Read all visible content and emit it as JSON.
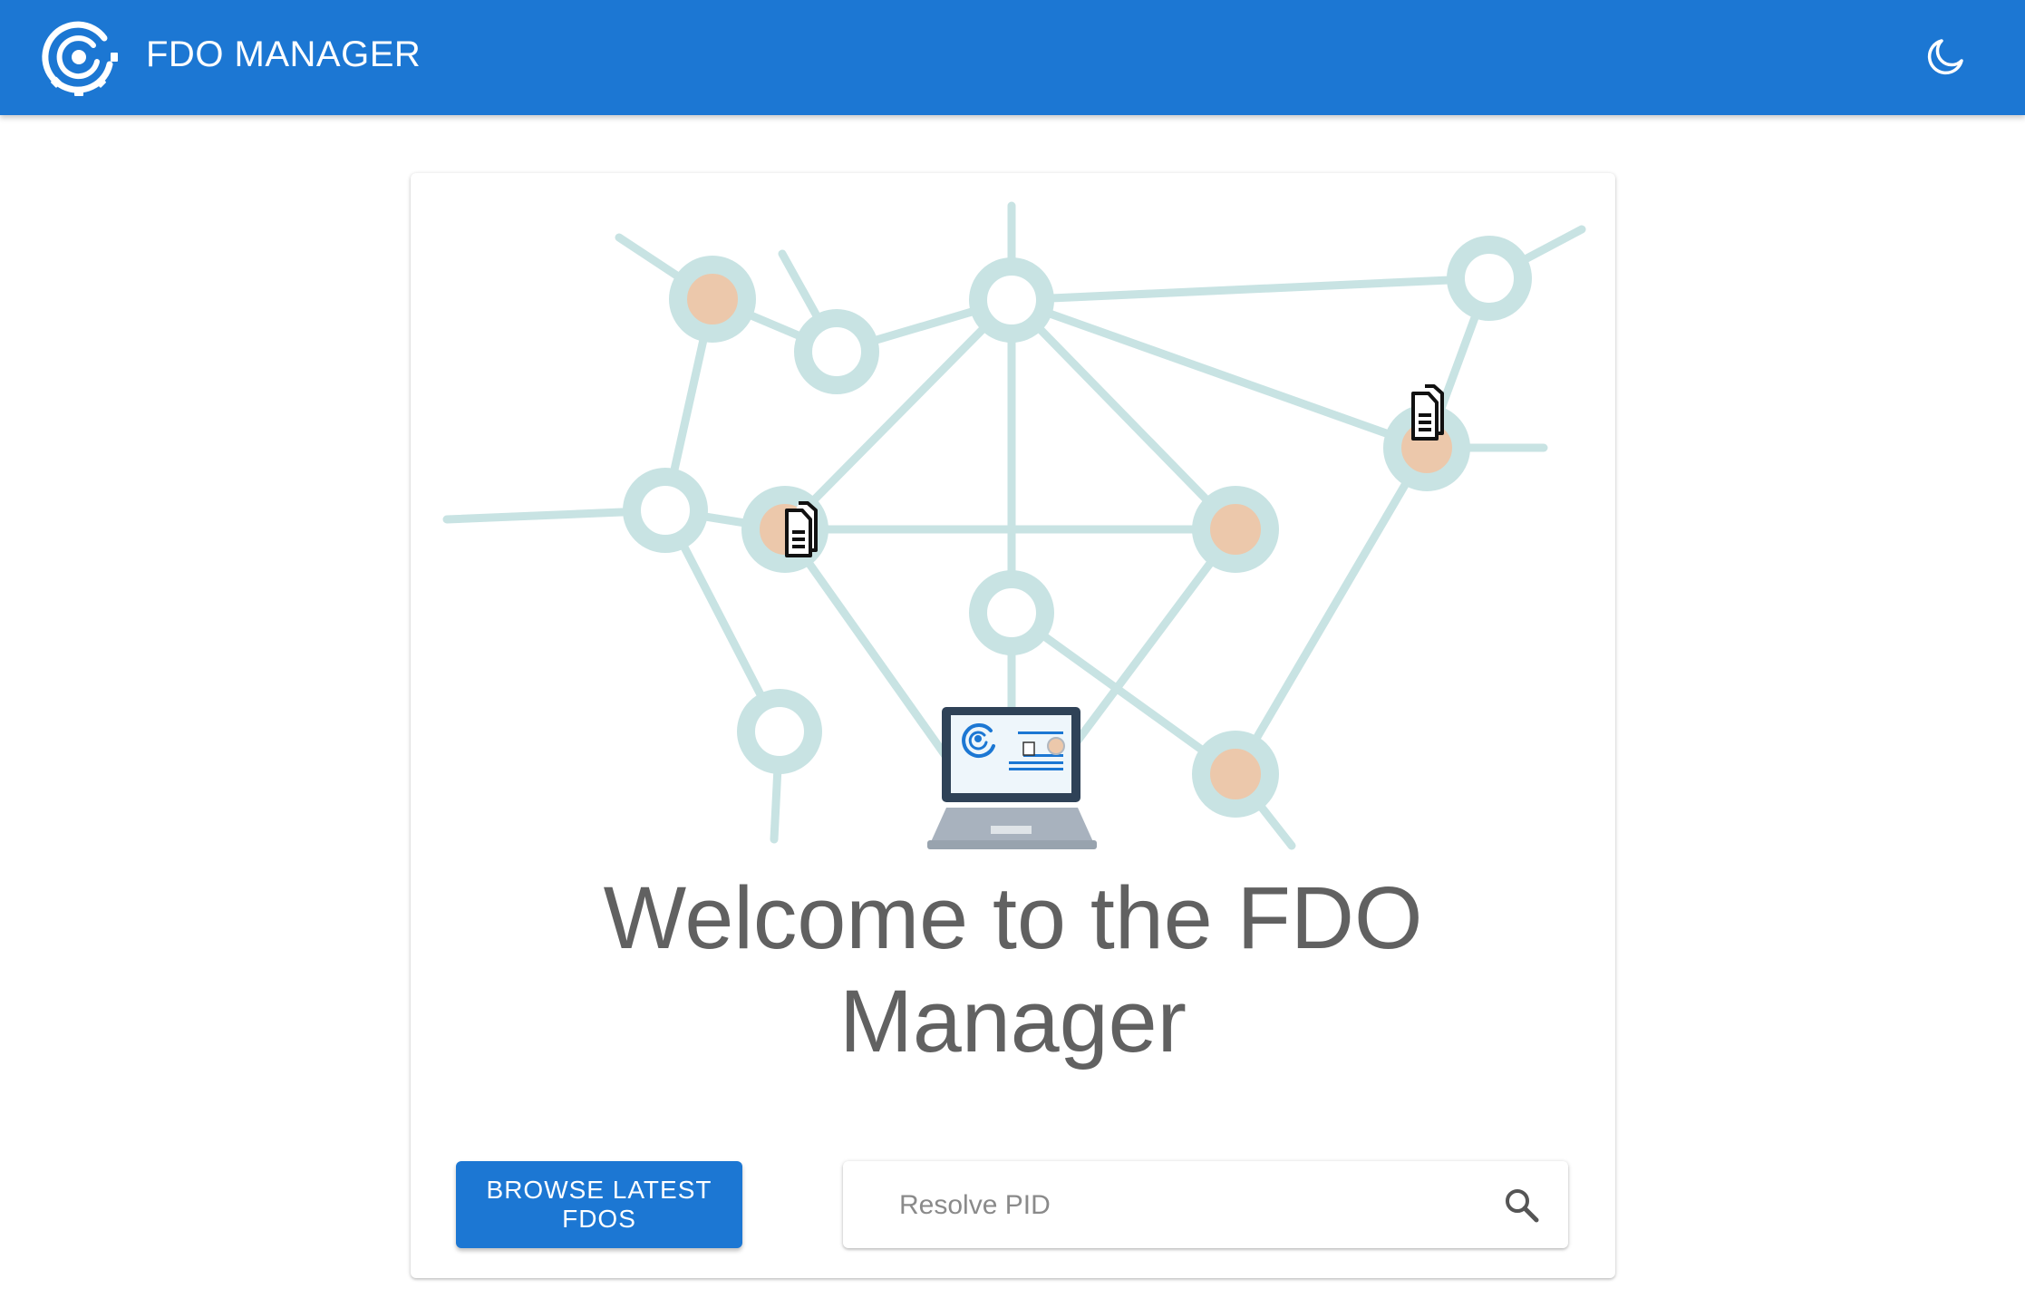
{
  "app": {
    "title": "FDO MANAGER",
    "brand_color": "#1c77d3"
  },
  "header": {
    "logo_icon": "fdo-target-gear-icon",
    "theme_toggle_icon": "moon-icon"
  },
  "hero": {
    "illustration": "network-graph-with-laptop",
    "node_ring_color": "#c8e3e3",
    "node_fill_color": "#ecc8ab",
    "laptop_frame_color": "#2f4257"
  },
  "main": {
    "welcome_line1": "Welcome to the FDO",
    "welcome_line2": "Manager",
    "browse_button_label": "BROWSE LATEST FDOS",
    "search_placeholder": "Resolve PID",
    "search_icon": "search-icon"
  }
}
